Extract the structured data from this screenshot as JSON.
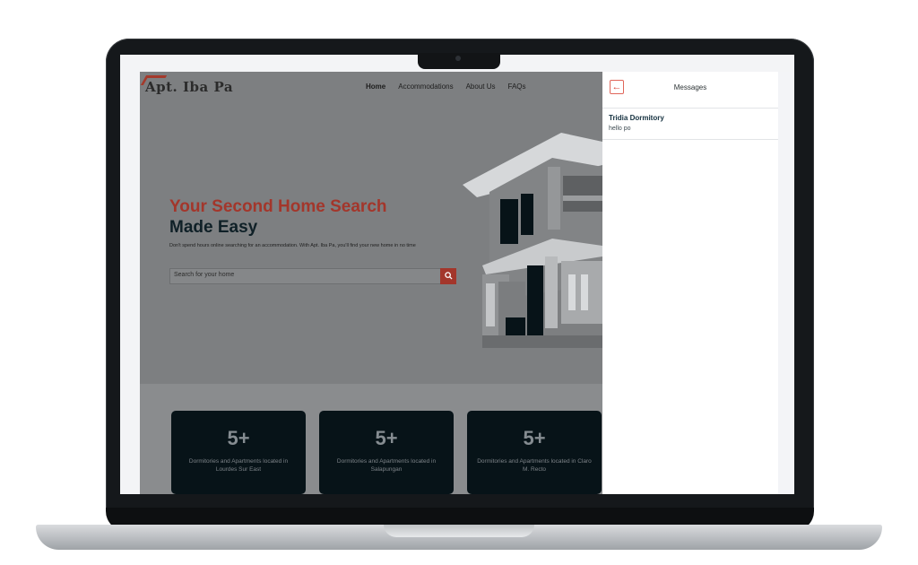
{
  "site": {
    "logo": "Apt. Iba Pa",
    "nav": [
      "Home",
      "Accommodations",
      "About Us",
      "FAQs"
    ],
    "hero": {
      "headline_1": "Your Second Home Search",
      "headline_2": "Made Easy",
      "subtitle": "Don't spend hours online searching for an accommodation. With Apt. Iba Pa, you'll find your new home in no time",
      "search_placeholder": "Search for your home"
    },
    "cards": [
      {
        "count": "5+",
        "label": "Dormitories and Apartments located in Lourdes Sur East"
      },
      {
        "count": "5+",
        "label": "Dormitories and Apartments located in Salapungan"
      },
      {
        "count": "5+",
        "label": "Dormitories and Apartments located in Claro M. Recto"
      }
    ]
  },
  "messages": {
    "title": "Messages",
    "back_icon": "arrow-left-icon",
    "threads": [
      {
        "name": "Tridia Dormitory",
        "preview": "hello po"
      }
    ]
  },
  "colors": {
    "accent": "#a3362b",
    "dark": "#071318",
    "panel_bg": "#ffffff"
  }
}
